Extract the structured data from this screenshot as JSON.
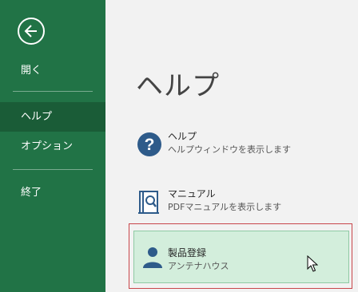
{
  "sidebar": {
    "items": [
      {
        "label": "開く"
      },
      {
        "label": "ヘルプ"
      },
      {
        "label": "オプション"
      },
      {
        "label": "終了"
      }
    ],
    "active_index": 1,
    "back_icon": "back-arrow-circle-icon"
  },
  "main": {
    "title": "ヘルプ",
    "entries": [
      {
        "title": "ヘルプ",
        "desc": "ヘルプウィンドウを表示します",
        "icon": "question-circle-icon"
      },
      {
        "title": "マニュアル",
        "desc": "PDFマニュアルを表示します",
        "icon": "manual-book-search-icon"
      },
      {
        "title": "製品登録",
        "desc": "アンテナハウス",
        "icon": "user-person-icon"
      }
    ]
  },
  "colors": {
    "sidebar_bg": "#217346",
    "sidebar_active": "#1a5c37",
    "selected_bg": "#d3eedc",
    "selected_border": "#c8454a",
    "icon_blue": "#2e5b8a"
  }
}
